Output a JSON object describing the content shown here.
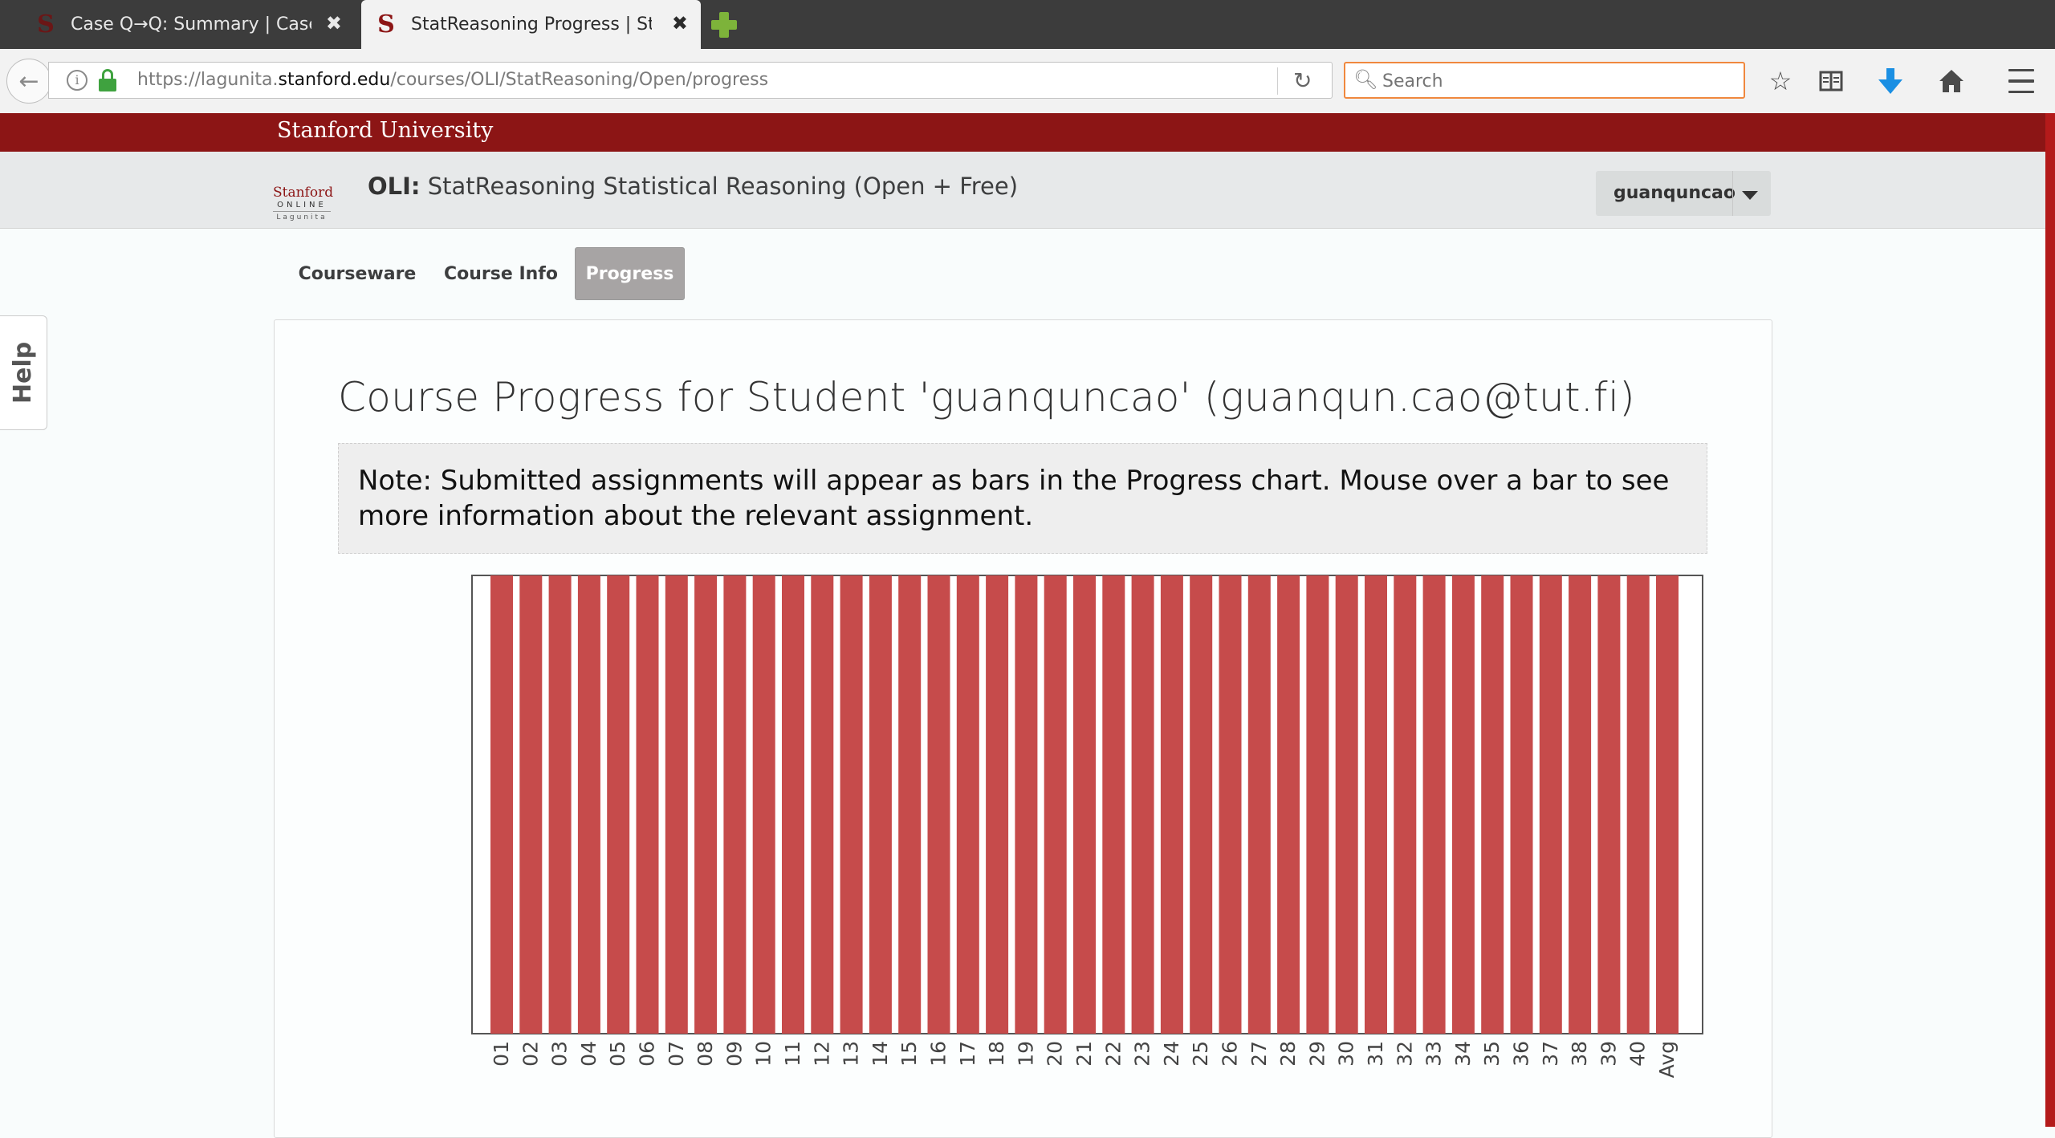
{
  "browser": {
    "tabs": [
      {
        "title": "Case Q→Q: Summary | Case …",
        "close": "✖",
        "favicon": "S"
      },
      {
        "title": "StatReasoning Progress | St…",
        "close": "✖",
        "favicon": "S"
      }
    ],
    "url": {
      "prefix": "https://lagunita.",
      "host": "stanford.edu",
      "path": "/courses/OLI/StatReasoning/Open/progress"
    },
    "search_placeholder": "Search",
    "icons": [
      "back-arrow-icon",
      "info-icon",
      "lock-icon",
      "reload-icon",
      "search-icon",
      "bookmark-star-icon",
      "reading-list-icon",
      "download-icon",
      "home-icon",
      "menu-icon"
    ]
  },
  "site": {
    "university": "Stanford University",
    "logo": {
      "line1": "Stanford",
      "line2": "ONLINE",
      "line3": "Lagunita"
    },
    "course_org": "OLI:",
    "course_name": "StatReasoning Statistical Reasoning (Open + Free)",
    "username": "guanquncao"
  },
  "nav": {
    "tabs": [
      {
        "label": "Courseware",
        "active": false
      },
      {
        "label": "Course Info",
        "active": false
      },
      {
        "label": "Progress",
        "active": true
      }
    ]
  },
  "help_label": "Help",
  "page": {
    "title": "Course Progress for Student 'guanquncao' (guanqun.cao@tut.fi)",
    "note": "Note: Submitted assignments will appear as bars in the Progress chart. Mouse over a bar to see more information about the relevant assignment."
  },
  "colors": {
    "bar": "#c64b4b",
    "brand_red": "#8c1515"
  },
  "chart_data": {
    "type": "bar",
    "categories": [
      "01",
      "02",
      "03",
      "04",
      "05",
      "06",
      "07",
      "08",
      "09",
      "10",
      "11",
      "12",
      "13",
      "14",
      "15",
      "16",
      "17",
      "18",
      "19",
      "20",
      "21",
      "22",
      "23",
      "24",
      "25",
      "26",
      "27",
      "28",
      "29",
      "30",
      "31",
      "32",
      "33",
      "34",
      "35",
      "36",
      "37",
      "38",
      "39",
      "40",
      "Avg"
    ],
    "values": [
      100,
      100,
      100,
      100,
      100,
      100,
      100,
      100,
      100,
      100,
      100,
      100,
      100,
      100,
      100,
      100,
      100,
      100,
      100,
      100,
      100,
      100,
      100,
      100,
      100,
      100,
      100,
      100,
      100,
      100,
      100,
      100,
      100,
      100,
      100,
      100,
      100,
      100,
      100,
      100,
      100
    ],
    "ylim": [
      0,
      100
    ],
    "grid": false,
    "legend": false
  }
}
